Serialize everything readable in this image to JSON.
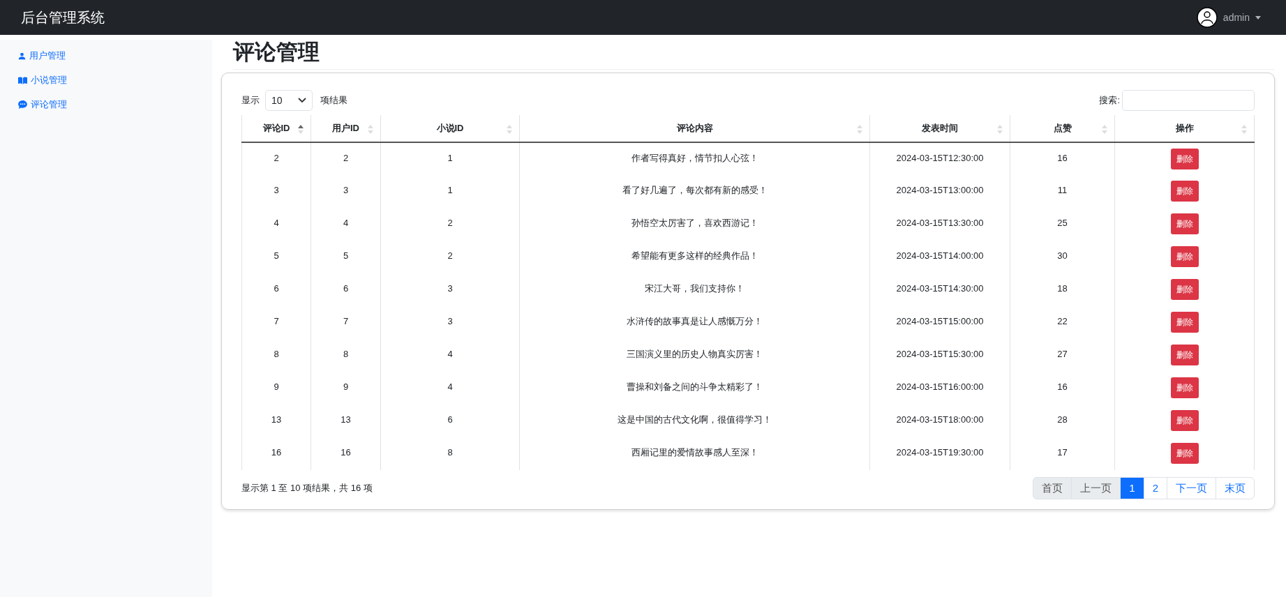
{
  "navbar": {
    "brand": "后台管理系统",
    "user": "admin"
  },
  "sidebar": {
    "items": [
      {
        "label": "用户管理",
        "selected": false
      },
      {
        "label": "小说管理",
        "selected": false
      },
      {
        "label": "评论管理",
        "selected": false
      }
    ]
  },
  "page_title": "评论管理",
  "length_control": {
    "prefix": "显示",
    "value": "10",
    "suffix": "项结果"
  },
  "search": {
    "label": "搜索:"
  },
  "table": {
    "columns": [
      {
        "label": "评论ID",
        "sorted": true
      },
      {
        "label": "用户ID",
        "sorted": false
      },
      {
        "label": "小说ID",
        "sorted": false
      },
      {
        "label": "评论内容",
        "sorted": false
      },
      {
        "label": "发表时间",
        "sorted": false
      },
      {
        "label": "点赞",
        "sorted": false
      },
      {
        "label": "操作",
        "sorted": false
      }
    ],
    "rows": [
      {
        "cells": [
          "2",
          "2",
          "1",
          "作者写得真好，情节扣人心弦！",
          "2024-03-15T12:30:00",
          "16"
        ],
        "action": "删除"
      },
      {
        "cells": [
          "3",
          "3",
          "1",
          "看了好几遍了，每次都有新的感受！",
          "2024-03-15T13:00:00",
          "11"
        ],
        "action": "删除"
      },
      {
        "cells": [
          "4",
          "4",
          "2",
          "孙悟空太厉害了，喜欢西游记！",
          "2024-03-15T13:30:00",
          "25"
        ],
        "action": "删除"
      },
      {
        "cells": [
          "5",
          "5",
          "2",
          "希望能有更多这样的经典作品！",
          "2024-03-15T14:00:00",
          "30"
        ],
        "action": "删除"
      },
      {
        "cells": [
          "6",
          "6",
          "3",
          "宋江大哥，我们支持你！",
          "2024-03-15T14:30:00",
          "18"
        ],
        "action": "删除"
      },
      {
        "cells": [
          "7",
          "7",
          "3",
          "水浒传的故事真是让人感慨万分！",
          "2024-03-15T15:00:00",
          "22"
        ],
        "action": "删除"
      },
      {
        "cells": [
          "8",
          "8",
          "4",
          "三国演义里的历史人物真实厉害！",
          "2024-03-15T15:30:00",
          "27"
        ],
        "action": "删除"
      },
      {
        "cells": [
          "9",
          "9",
          "4",
          "曹操和刘备之间的斗争太精彩了！",
          "2024-03-15T16:00:00",
          "16"
        ],
        "action": "删除"
      },
      {
        "cells": [
          "13",
          "13",
          "6",
          "这是中国的古代文化啊，很值得学习！",
          "2024-03-15T18:00:00",
          "28"
        ],
        "action": "删除"
      },
      {
        "cells": [
          "16",
          "16",
          "8",
          "西厢记里的爱情故事感人至深！",
          "2024-03-15T19:30:00",
          "17"
        ],
        "action": "删除"
      }
    ]
  },
  "info": "显示第 1 至 10 项结果，共 16 项",
  "pagination": [
    {
      "label": "首页",
      "selected": false,
      "disabled": true
    },
    {
      "label": "上一页",
      "selected": false,
      "disabled": true
    },
    {
      "label": "1",
      "selected": true,
      "disabled": false
    },
    {
      "label": "2",
      "selected": false,
      "disabled": false
    },
    {
      "label": "下一页",
      "selected": false,
      "disabled": false
    },
    {
      "label": "末页",
      "selected": false,
      "disabled": false
    }
  ]
}
